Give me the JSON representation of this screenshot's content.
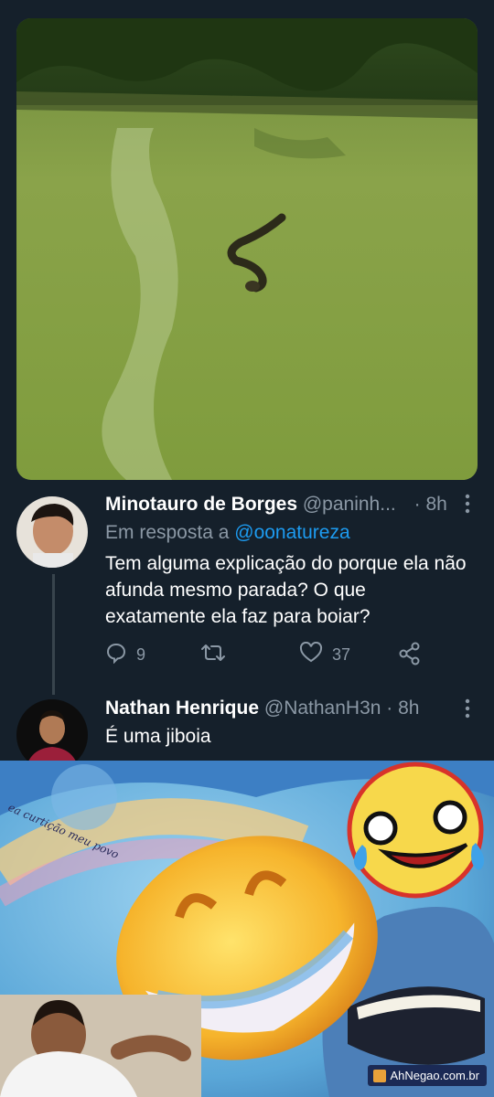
{
  "tweet1": {
    "name": "Minotauro de Borges",
    "handle": "@paninh...",
    "separator": "·",
    "time": "8h",
    "reply_prefix": "Em resposta a",
    "reply_mention": "@oonatureza",
    "text": "Tem alguma explicação do porque ela não afunda mesmo parada? O que exatamente ela faz para boiar?",
    "replies": "9",
    "retweets": "",
    "likes": "37"
  },
  "tweet2": {
    "name": "Nathan Henrique",
    "handle": "@NathanH3n",
    "separator": "·",
    "time": "8h",
    "text": "É uma jiboia"
  },
  "meme": {
    "caption": "ea curtição meu povo",
    "watermark": "AhNegao.com.br"
  },
  "icons": [
    "more-icon",
    "reply-icon",
    "retweet-icon",
    "like-icon",
    "share-icon"
  ],
  "colors": {
    "background": "#15202b",
    "text": "#ffffff",
    "secondary": "#8b98a5",
    "link": "#1d9bf0"
  }
}
